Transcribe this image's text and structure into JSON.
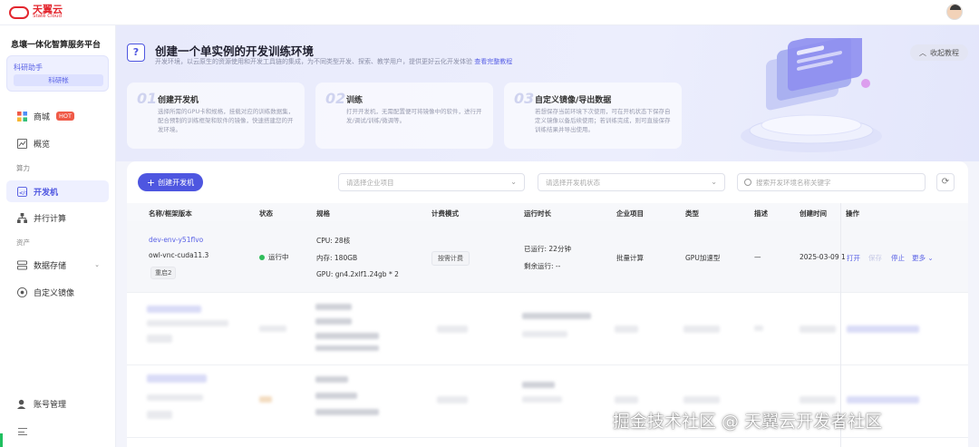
{
  "brand": {
    "name_cn": "天翼云",
    "name_en": "State Cloud",
    "color": "#e3262e"
  },
  "sidebar": {
    "platform_title": "息壤一体化智算服务平台",
    "workspace": {
      "name": "科研助手",
      "tag": "科研帐"
    },
    "items": [
      {
        "label": "商城",
        "icon": "shop-icon",
        "badge": "HOT"
      },
      {
        "label": "概览",
        "icon": "overview-icon"
      }
    ],
    "section_compute": "算力",
    "compute_items": [
      {
        "label": "开发机",
        "icon": "devbox-icon",
        "active": true
      },
      {
        "label": "并行计算",
        "icon": "parallel-icon"
      }
    ],
    "section_assets": "资产",
    "asset_items": [
      {
        "label": "数据存储",
        "icon": "storage-icon"
      },
      {
        "label": "自定义镜像",
        "icon": "image-icon"
      }
    ],
    "account": "账号管理"
  },
  "banner": {
    "title": "创建一个单实例的开发训练环境",
    "desc": "开发环境，以云原生的资源使用和开发工具链的集成，为不同类型开发、探索、教学用户，提供更好云化开发体验",
    "link": "查看完整教程",
    "collapse": "收起教程",
    "steps": [
      {
        "num": "01",
        "title": "创建开发机",
        "desc": "选择所需的GPU卡和规格，挂载对应的训练数据集，配合预制的训练框架和软件的镜像，快速搭建您的开发环境。"
      },
      {
        "num": "02",
        "title": "训练",
        "desc": "打开开发机，无需配置便可将镜像中的软件，进行开发/调试/训练/微调等。"
      },
      {
        "num": "03",
        "title": "自定义镜像/导出数据",
        "desc": "若想保存当前环境下次使用，可在开机状态下保存自定义镜像以备后续使用；若训练完成，则可直接保存训练结果并导出使用。"
      }
    ]
  },
  "toolbar": {
    "create": "创建开发机",
    "project_placeholder": "请选择企业项目",
    "status_placeholder": "请选择开发机状态",
    "search_placeholder": "搜索开发环境名称关键字"
  },
  "table": {
    "headers": [
      "名称/框架版本",
      "状态",
      "规格",
      "计费模式",
      "运行时长",
      "企业项目",
      "类型",
      "描述",
      "创建时间",
      "操作"
    ],
    "rows": [
      {
        "name": "dev-env-y51flvo",
        "image": "owl-vnc-cuda11.3",
        "tag": "重启2",
        "status": "运行中",
        "spec_cpu": "CPU: 28核",
        "spec_mem": "内存: 180GB",
        "spec_gpu": "GPU: gn4.2xlf1.24gb * 2",
        "billing": "按需计费",
        "run_time": "已运行: 22分钟",
        "remaining": "剩余运行: --",
        "project": "批量计算",
        "type": "GPU加速型",
        "desc": "—",
        "created": "2025-03-09 1",
        "actions": [
          "打开",
          "保存",
          "停止",
          "更多"
        ]
      }
    ]
  },
  "watermark": "掘金技术社区 @ 天翼云开发者社区"
}
